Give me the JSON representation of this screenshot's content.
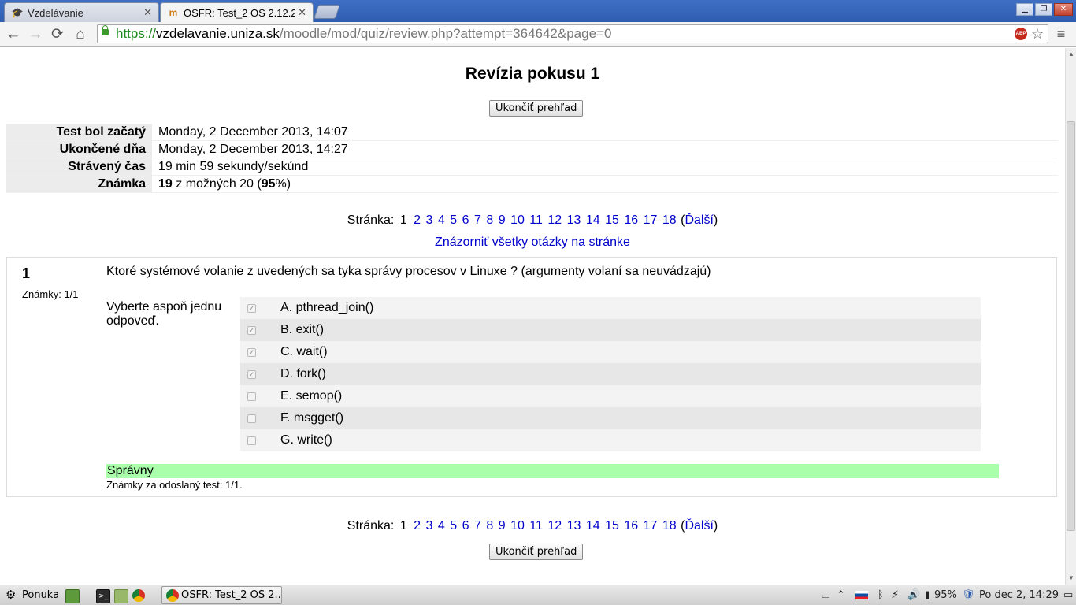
{
  "browser": {
    "tabs": [
      {
        "title": "Vzdelávanie",
        "active": false,
        "icon": "graduation-cap-icon"
      },
      {
        "title": "OSFR: Test_2 OS 2.12.2",
        "active": true,
        "icon": "moodle-icon"
      }
    ],
    "url_scheme": "https://",
    "url_host": "vzdelavanie.uniza.sk",
    "url_path": "/moodle/mod/quiz/review.php?attempt=364642&page=0",
    "adblock_label": "ABP"
  },
  "page": {
    "title": "Revízia pokusu 1",
    "finish_review_label": "Ukončiť prehľad",
    "summary": [
      {
        "label": "Test bol začatý",
        "value": "Monday, 2 December 2013, 14:07"
      },
      {
        "label": "Ukončené dňa",
        "value": "Monday, 2 December 2013, 14:27"
      },
      {
        "label": "Strávený čas",
        "value": "19 min 59 sekundy/sekúnd"
      }
    ],
    "grade": {
      "label": "Známka",
      "score": "19",
      "middle": " z možných 20 (",
      "percent": "95",
      "suffix": "%)"
    },
    "paging": {
      "label": "Stránka:",
      "current": "1",
      "pages": [
        "2",
        "3",
        "4",
        "5",
        "6",
        "7",
        "8",
        "9",
        "10",
        "11",
        "12",
        "13",
        "14",
        "15",
        "16",
        "17",
        "18"
      ],
      "next_open": "(",
      "next": "Ďalší",
      "next_close": ")"
    },
    "show_all_label": "Znázorniť všetky otázky na stránke",
    "question": {
      "number": "1",
      "grade_label": "Známky: 1/1",
      "text": "Ktoré systémové volanie z uvedených sa tyka správy procesov v Linuxe ? (argumenty volaní sa neuvádzajú)",
      "prompt": "Vyberte aspoň jednu odpoveď.",
      "answers": [
        {
          "label": "A. pthread_join()",
          "checked": true
        },
        {
          "label": "B. exit()",
          "checked": true
        },
        {
          "label": "C. wait()",
          "checked": true
        },
        {
          "label": "D. fork()",
          "checked": true
        },
        {
          "label": "E. semop()",
          "checked": false
        },
        {
          "label": "F. msgget()",
          "checked": false
        },
        {
          "label": "G. write()",
          "checked": false
        }
      ],
      "feedback": "Správny",
      "feedback_color": "#aaffaa",
      "submitted_grade": "Známky za odoslaný test: 1/1."
    }
  },
  "taskbar": {
    "menu_label": "Ponuka",
    "window_label": "OSFR: Test_2 OS 2....",
    "battery": "95%",
    "clock": "Po dec  2, 14:29"
  },
  "colors": {
    "link": "#0000cc",
    "tabbar": "#3e6fc4"
  }
}
